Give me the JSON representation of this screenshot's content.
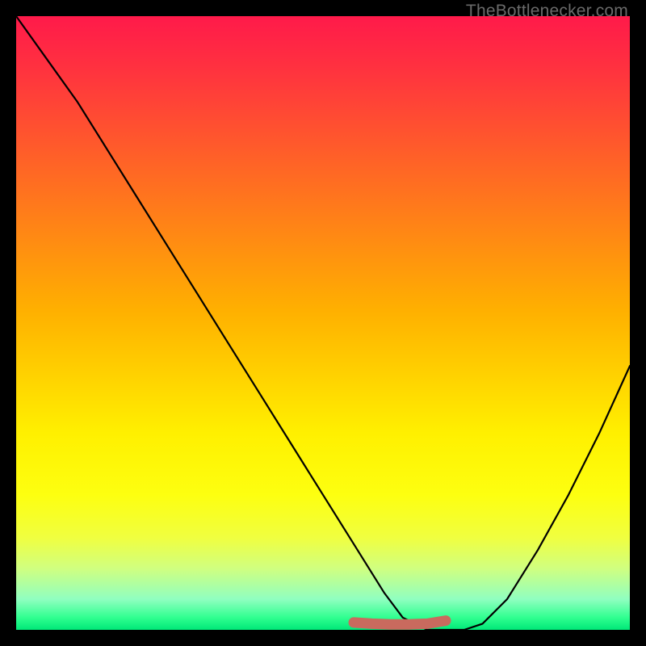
{
  "watermark": "TheBottlenecker.com",
  "chart_data": {
    "type": "line",
    "title": "",
    "xlabel": "",
    "ylabel": "",
    "xlim": [
      0,
      100
    ],
    "ylim": [
      0,
      100
    ],
    "series": [
      {
        "name": "bottleneck-curve",
        "x": [
          0,
          5,
          10,
          15,
          20,
          25,
          30,
          35,
          40,
          45,
          50,
          55,
          60,
          63,
          67,
          70,
          73,
          76,
          80,
          85,
          90,
          95,
          100
        ],
        "y": [
          100,
          93,
          86,
          78,
          70,
          62,
          54,
          46,
          38,
          30,
          22,
          14,
          6,
          2,
          0,
          0,
          0,
          1,
          5,
          13,
          22,
          32,
          43
        ]
      }
    ],
    "highlight": {
      "name": "sweet-spot",
      "x": [
        55,
        58,
        61,
        64,
        67,
        70
      ],
      "y": [
        1.2,
        1.0,
        0.9,
        0.9,
        1.0,
        1.5
      ]
    },
    "colors": {
      "curve": "#000000",
      "highlight": "#c96a5e",
      "background_top": "#ff1a4a",
      "background_bottom": "#00e878",
      "frame": "#000000"
    }
  }
}
